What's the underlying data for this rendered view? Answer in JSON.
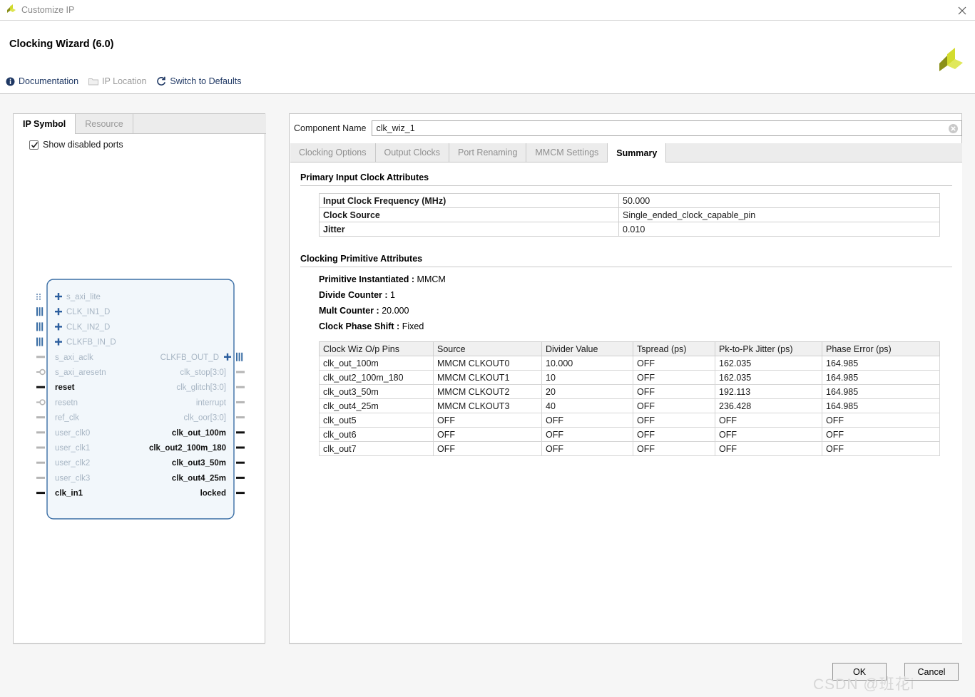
{
  "window": {
    "title": "Customize IP",
    "app_icon": "xilinx-logo-icon",
    "close_icon": "close-icon"
  },
  "header": {
    "ip_title": "Clocking Wizard (6.0)",
    "brand_logo": "xilinx-logo-icon",
    "toolbar": [
      {
        "label": "Documentation",
        "icon": "info-icon",
        "disabled": false
      },
      {
        "label": "IP Location",
        "icon": "folder-icon",
        "disabled": true
      },
      {
        "label": "Switch to Defaults",
        "icon": "refresh-icon",
        "disabled": false
      }
    ]
  },
  "left_panel": {
    "tabs": [
      {
        "label": "IP Symbol",
        "active": true
      },
      {
        "label": "Resource",
        "active": false
      }
    ],
    "show_disabled_ports": {
      "label": "Show disabled ports",
      "checked": true
    },
    "symbol": {
      "inputs": [
        {
          "name": "s_axi_lite",
          "enabled": false,
          "connector": "bus-dotted",
          "expandable": true
        },
        {
          "name": "CLK_IN1_D",
          "enabled": false,
          "connector": "bus-solid",
          "expandable": true
        },
        {
          "name": "CLK_IN2_D",
          "enabled": false,
          "connector": "bus-solid",
          "expandable": true
        },
        {
          "name": "CLKFB_IN_D",
          "enabled": false,
          "connector": "bus-solid",
          "expandable": true
        },
        {
          "name": "s_axi_aclk",
          "enabled": false,
          "connector": "pin",
          "expandable": false
        },
        {
          "name": "s_axi_aresetn",
          "enabled": false,
          "connector": "pin-inv",
          "expandable": false
        },
        {
          "name": "reset",
          "enabled": true,
          "connector": "pin",
          "expandable": false
        },
        {
          "name": "resetn",
          "enabled": false,
          "connector": "pin-inv",
          "expandable": false
        },
        {
          "name": "ref_clk",
          "enabled": false,
          "connector": "pin",
          "expandable": false
        },
        {
          "name": "user_clk0",
          "enabled": false,
          "connector": "pin",
          "expandable": false
        },
        {
          "name": "user_clk1",
          "enabled": false,
          "connector": "pin",
          "expandable": false
        },
        {
          "name": "user_clk2",
          "enabled": false,
          "connector": "pin",
          "expandable": false
        },
        {
          "name": "user_clk3",
          "enabled": false,
          "connector": "pin",
          "expandable": false
        },
        {
          "name": "clk_in1",
          "enabled": true,
          "connector": "pin",
          "expandable": false
        }
      ],
      "outputs": [
        {
          "name": "CLKFB_OUT_D",
          "enabled": false,
          "connector": "bus-solid",
          "expandable": true
        },
        {
          "name": "clk_stop[3:0]",
          "enabled": false,
          "connector": "pin",
          "expandable": false
        },
        {
          "name": "clk_glitch[3:0]",
          "enabled": false,
          "connector": "pin",
          "expandable": false
        },
        {
          "name": "interrupt",
          "enabled": false,
          "connector": "pin",
          "expandable": false
        },
        {
          "name": "clk_oor[3:0]",
          "enabled": false,
          "connector": "pin",
          "expandable": false
        },
        {
          "name": "clk_out_100m",
          "enabled": true,
          "connector": "pin",
          "expandable": false
        },
        {
          "name": "clk_out2_100m_180",
          "enabled": true,
          "connector": "pin",
          "expandable": false
        },
        {
          "name": "clk_out3_50m",
          "enabled": true,
          "connector": "pin",
          "expandable": false
        },
        {
          "name": "clk_out4_25m",
          "enabled": true,
          "connector": "pin",
          "expandable": false
        },
        {
          "name": "locked",
          "enabled": true,
          "connector": "pin",
          "expandable": false
        }
      ]
    }
  },
  "right_panel": {
    "component_name": {
      "label": "Component Name",
      "value": "clk_wiz_1",
      "placeholder": "",
      "clear_icon": "clear-circle-icon"
    },
    "tabs": [
      {
        "label": "Clocking Options",
        "active": false
      },
      {
        "label": "Output Clocks",
        "active": false
      },
      {
        "label": "Port Renaming",
        "active": false
      },
      {
        "label": "MMCM Settings",
        "active": false
      },
      {
        "label": "Summary",
        "active": true
      }
    ],
    "summary": {
      "primary_input_clock": {
        "title": "Primary Input Clock Attributes",
        "rows": [
          {
            "key": "Input Clock Frequency (MHz)",
            "value": "50.000"
          },
          {
            "key": "Clock Source",
            "value": "Single_ended_clock_capable_pin"
          },
          {
            "key": "Jitter",
            "value": "0.010"
          }
        ]
      },
      "clocking_primitive": {
        "title": "Clocking Primitive Attributes",
        "attributes": [
          {
            "key": "Primitive Instantiated :",
            "value": "MMCM"
          },
          {
            "key": "Divide Counter :",
            "value": "1"
          },
          {
            "key": "Mult Counter :",
            "value": "20.000"
          },
          {
            "key": "Clock Phase Shift :",
            "value": "Fixed"
          }
        ],
        "table": {
          "columns": [
            "Clock Wiz O/p Pins",
            "Source",
            "Divider Value",
            "Tspread (ps)",
            "Pk-to-Pk Jitter (ps)",
            "Phase Error (ps)"
          ],
          "rows": [
            [
              "clk_out_100m",
              "MMCM CLKOUT0",
              "10.000",
              "OFF",
              "162.035",
              "164.985"
            ],
            [
              "clk_out2_100m_180",
              "MMCM CLKOUT1",
              "10",
              "OFF",
              "162.035",
              "164.985"
            ],
            [
              "clk_out3_50m",
              "MMCM CLKOUT2",
              "20",
              "OFF",
              "192.113",
              "164.985"
            ],
            [
              "clk_out4_25m",
              "MMCM CLKOUT3",
              "40",
              "OFF",
              "236.428",
              "164.985"
            ],
            [
              "clk_out5",
              "OFF",
              "OFF",
              "OFF",
              "OFF",
              "OFF"
            ],
            [
              "clk_out6",
              "OFF",
              "OFF",
              "OFF",
              "OFF",
              "OFF"
            ],
            [
              "clk_out7",
              "OFF",
              "OFF",
              "OFF",
              "OFF",
              "OFF"
            ]
          ]
        }
      }
    }
  },
  "footer": {
    "ok_label": "OK",
    "cancel_label": "Cancel"
  },
  "watermark": "CSDN @班花i",
  "colors": {
    "link_blue": "#1f3864",
    "symbol_border": "#3a6ea5",
    "symbol_fill": "#f2f7fb",
    "disabled_text": "#a8b6c4",
    "enabled_text": "#111111",
    "brand_yellow": "#cfd92b",
    "brand_olive": "#8a901a"
  }
}
